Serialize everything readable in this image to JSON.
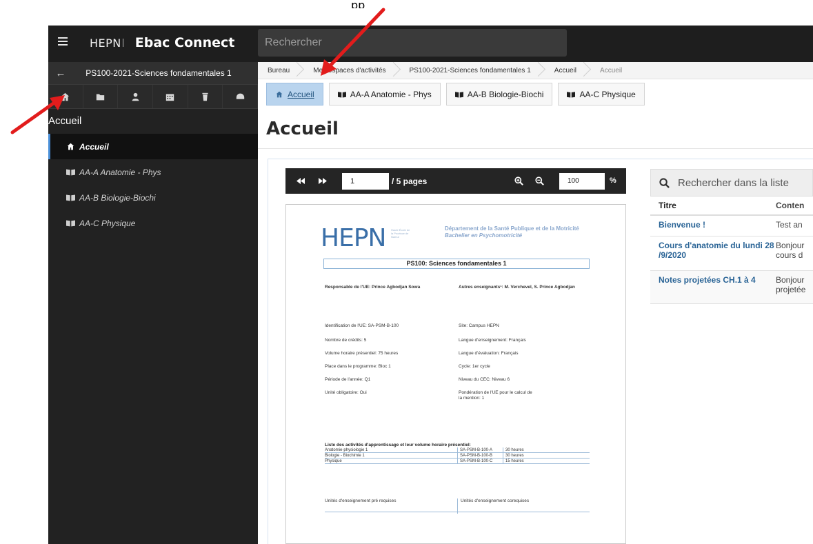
{
  "header": {
    "brand_logo": "HEPN",
    "app_name": "Ebac Connect",
    "search_placeholder": "Rechercher",
    "top_text_fragment": "pp"
  },
  "sidebar": {
    "course": "PS100-2021-Sciences fondamentales 1",
    "section_title": "Accueil",
    "icons": [
      "home-icon",
      "folder-icon",
      "user-icon",
      "calendar-icon",
      "trash-icon",
      "dashboard-icon"
    ],
    "items": [
      {
        "label": "Accueil",
        "active": true
      },
      {
        "label": "AA-A Anatomie - Phys",
        "active": false
      },
      {
        "label": "AA-B Biologie-Biochi",
        "active": false
      },
      {
        "label": "AA-C Physique",
        "active": false
      }
    ]
  },
  "breadcrumb": [
    "Bureau",
    "Mes espaces d'activités",
    "PS100-2021-Sciences fondamentales 1",
    "Accueil",
    "Accueil"
  ],
  "tabs": [
    {
      "label": "Accueil",
      "icon": "home-icon",
      "active": true
    },
    {
      "label": "AA-A Anatomie - Phys",
      "icon": "book-icon",
      "active": false
    },
    {
      "label": "AA-B Biologie-Biochi",
      "icon": "book-icon",
      "active": false
    },
    {
      "label": "AA-C Physique",
      "icon": "book-icon",
      "active": false
    }
  ],
  "page_title": "Accueil",
  "pdf_viewer": {
    "page_value": "1",
    "page_count": "/ 5 pages",
    "zoom_value": "100",
    "zoom_unit": "%"
  },
  "document": {
    "logo": "HEPN",
    "logo_side_text": "Haute École de la Province de Namur",
    "department": "Département de la Santé Publique et de la Motricité",
    "degree": "Bachelier en Psychomotricité",
    "box_title": "PS100: Sciences fondamentales 1",
    "responsable": "Responsable de l'UE: Prince Agbodjan Sowa",
    "autres_enseignants": "Autres enseignants¹: M. Verchevel, S. Prince Agbodjan",
    "left_fields": [
      "Identification de l'UE: SA-PSM-B-100",
      "Nombre de crédits: 5",
      "Volume horaire présentiel: 75 heures",
      "Place dans le programme: Bloc 1",
      "Période de l'année: Q1",
      "Unité obligatoire: Oui"
    ],
    "right_fields": [
      "Site: Campus HEPN",
      "Langue d'enseignement: Français",
      "Langue d'évaluation: Français",
      "Cycle: 1er cycle",
      "Niveau du CEC: Niveau 6",
      "Pondération de l'UE pour le calcul de la mention: 1"
    ],
    "activities_heading": "Liste des activités d'apprentissage et leur volume horaire présentiel:",
    "activities": [
      {
        "name": "Anatomie-physiologie 1",
        "code": "SA-PSM-B-100-A",
        "hours": "30 heures"
      },
      {
        "name": "Biologie - Biochimie 1",
        "code": "SA-PSM-B-100-B",
        "hours": "30 heures"
      },
      {
        "name": "Physique",
        "code": "SA-PSM-B-100-C",
        "hours": "15 heures"
      }
    ],
    "prereq_left": "Unités d'enseignement pré requises",
    "prereq_right": "Unités d'enseignement corequises"
  },
  "list": {
    "search_placeholder": "Rechercher dans la liste",
    "columns": [
      "Titre",
      "Conten"
    ],
    "rows": [
      {
        "title": "Bienvenue !",
        "content": "Test an"
      },
      {
        "title": "Cours d'anatomie du lundi 28 /9/2020",
        "content": "Bonjour cours d"
      },
      {
        "title": "Notes projetées CH.1 à 4",
        "content": "Bonjour projetée"
      }
    ]
  },
  "colors": {
    "topbar": "#1e1e1e",
    "sidebar": "#222222",
    "active_tab": "#b9d4ee",
    "link": "#2a6496",
    "annotation_arrow": "#e21c1c"
  }
}
